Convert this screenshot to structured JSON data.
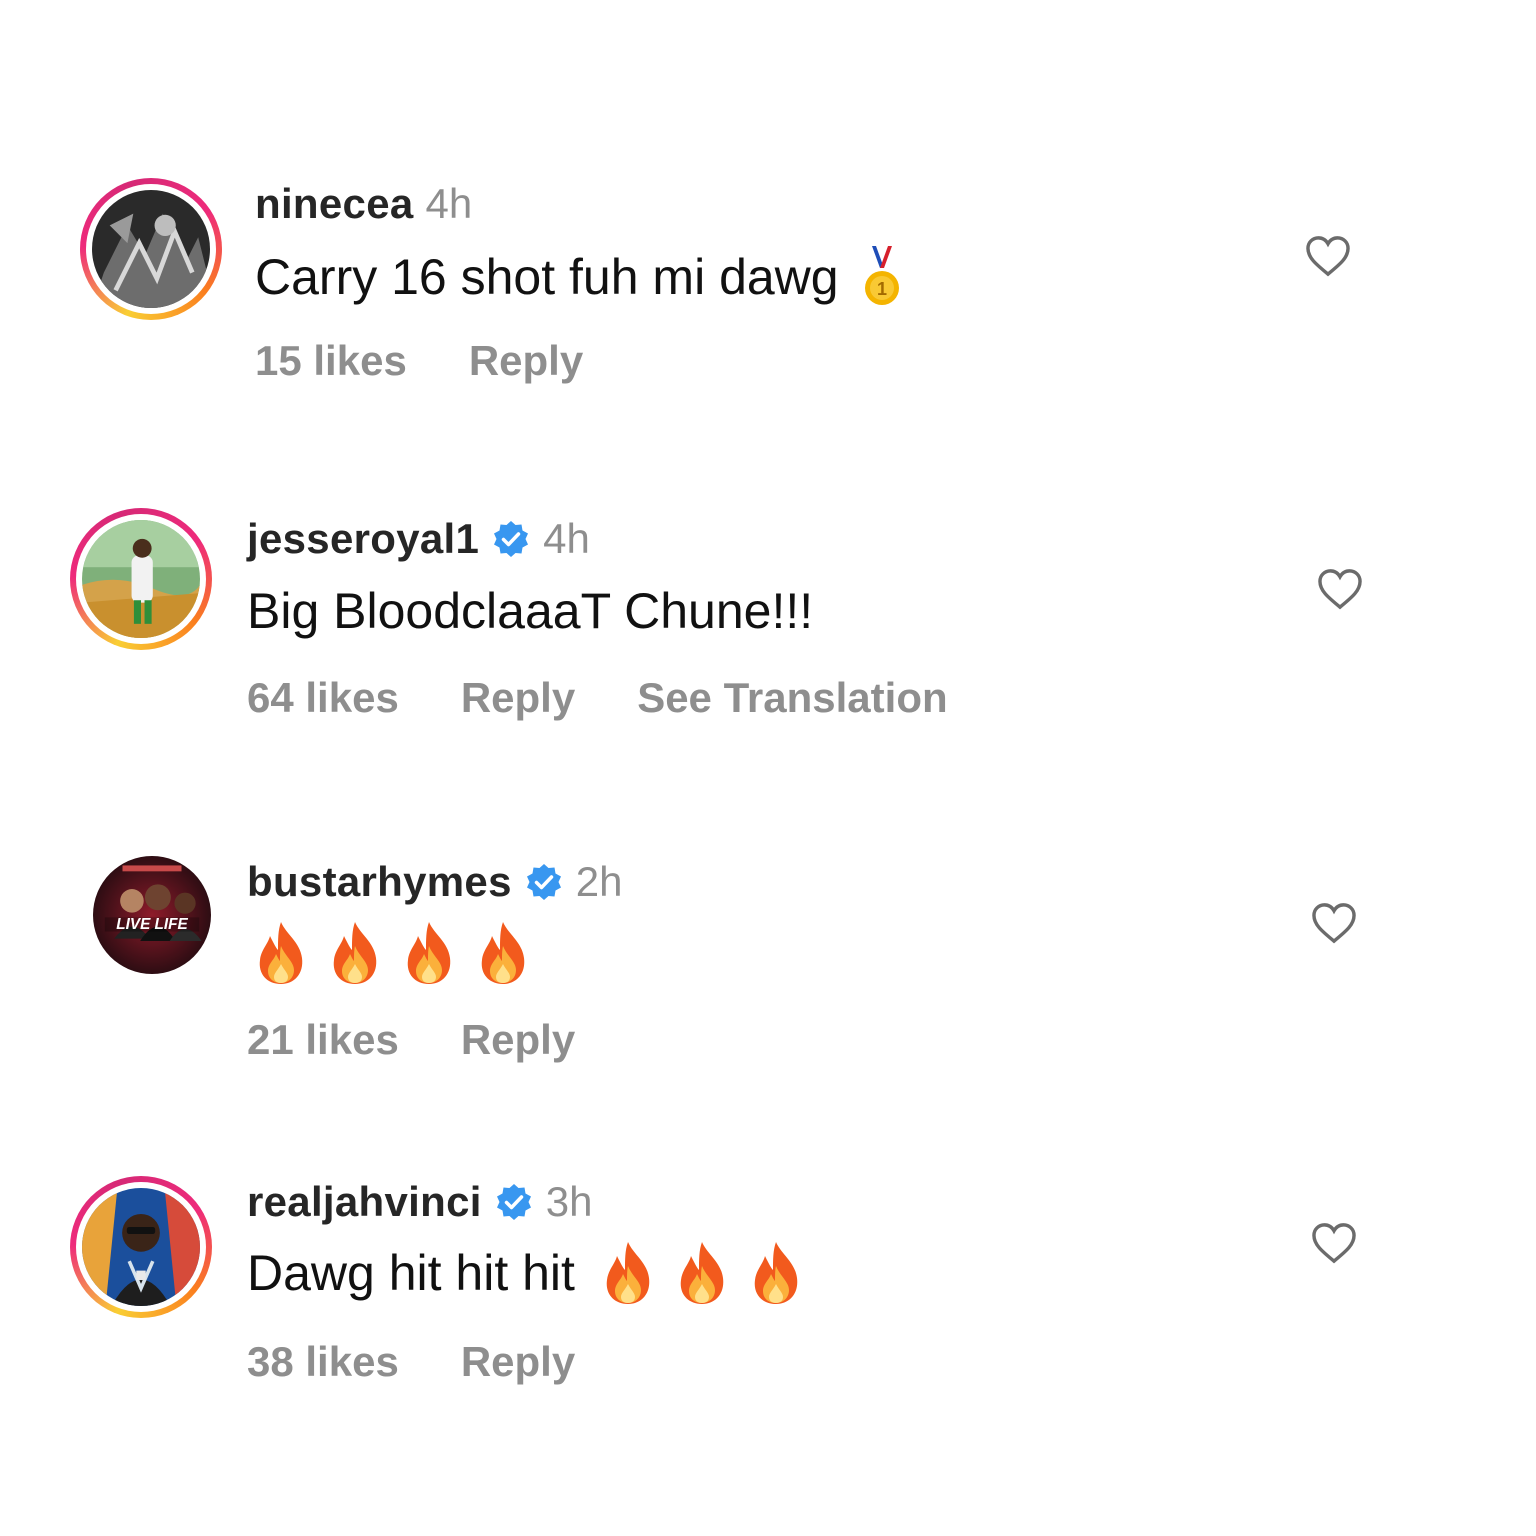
{
  "comments": [
    {
      "username": "ninecea",
      "verified": false,
      "time": "4h",
      "text": "Carry 16 shot fuh mi dawg",
      "emojis": [
        "medal-emoji"
      ],
      "likes": "15 likes",
      "reply": "Reply",
      "translation": "",
      "avatar_ring": "story"
    },
    {
      "username": "jesseroyal1",
      "verified": true,
      "time": "4h",
      "text": "Big BloodclaaaT Chune!!!",
      "emojis": [],
      "likes": "64 likes",
      "reply": "Reply",
      "translation": "See Translation",
      "avatar_ring": "story"
    },
    {
      "username": "bustarhymes",
      "verified": true,
      "time": "2h",
      "text": "",
      "emojis": [
        "fire-emoji",
        "fire-emoji",
        "fire-emoji",
        "fire-emoji"
      ],
      "likes": "21 likes",
      "reply": "Reply",
      "translation": "",
      "avatar_ring": "none",
      "avatar_text": "LIVE LIFE"
    },
    {
      "username": "realjahvinci",
      "verified": true,
      "time": "3h",
      "text": "Dawg hit hit hit",
      "emojis": [
        "fire-emoji",
        "fire-emoji",
        "fire-emoji"
      ],
      "likes": "38 likes",
      "reply": "Reply",
      "translation": "",
      "avatar_ring": "story"
    }
  ],
  "colors": {
    "verified_blue": "#3897f0",
    "secondary_text": "#8e8e8e",
    "primary_text": "#111111"
  }
}
